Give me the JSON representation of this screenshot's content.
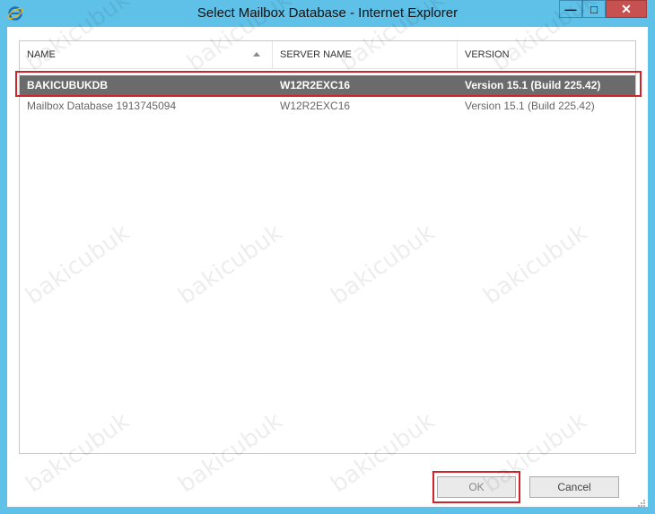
{
  "window": {
    "title": "Select Mailbox Database - Internet Explorer",
    "icon": "internet-explorer-icon",
    "minimize_icon": "minimize-icon",
    "maximize_icon": "maximize-icon",
    "close_icon": "close-icon",
    "minimize_glyph": "—",
    "maximize_glyph": "□",
    "close_glyph": "✕"
  },
  "grid": {
    "columns": [
      {
        "label": "NAME",
        "sorted": "ascending"
      },
      {
        "label": "SERVER NAME"
      },
      {
        "label": "VERSION"
      }
    ],
    "rows": [
      {
        "name": "BAKICUBUKDB",
        "server": "W12R2EXC16",
        "version": "Version 15.1 (Build 225.42)",
        "selected": true
      },
      {
        "name": "Mailbox Database 1913745094",
        "server": "W12R2EXC16",
        "version": "Version 15.1 (Build 225.42)",
        "selected": false
      }
    ]
  },
  "buttons": {
    "ok": "OK",
    "cancel": "Cancel"
  },
  "watermark": "bakicubuk",
  "colors": {
    "frame": "#5fc1e8",
    "selected_row": "#6b6b6b",
    "highlight": "#d0232a"
  }
}
